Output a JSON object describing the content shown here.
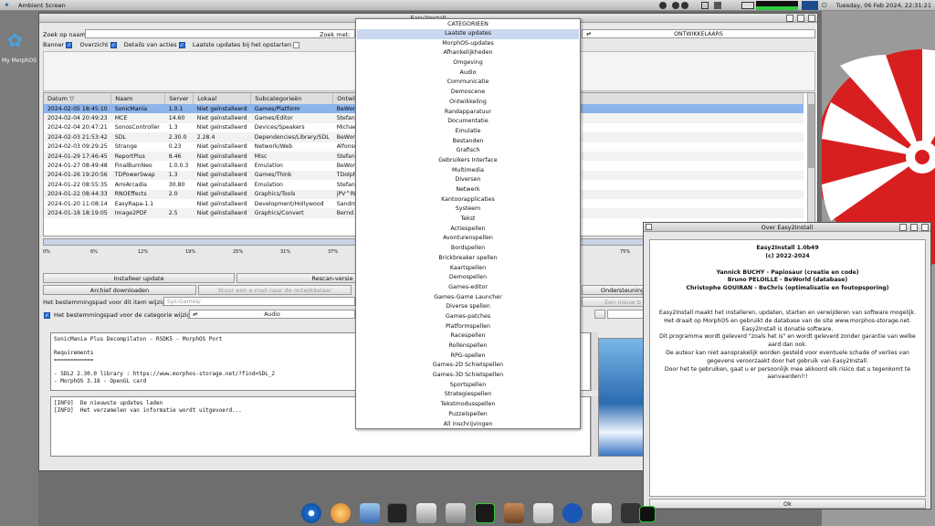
{
  "screenbar": {
    "title": "Ambient Screen",
    "clock": "Tuesday, 06 Feb 2024, 22:31:21"
  },
  "desktop": {
    "icon_label": "My MorphOS"
  },
  "main": {
    "title": "Easy2Install",
    "search_name_label": "Zoek op naam:",
    "search_with_label": "Zoek met:",
    "category_value": "ONTWIKKELAARS",
    "options": [
      {
        "label": "Banner",
        "checked": true
      },
      {
        "label": "Overzicht",
        "checked": true
      },
      {
        "label": "Details van acties",
        "checked": true
      },
      {
        "label": "Laatste updates bij het opstarten",
        "checked": false
      }
    ],
    "columns": [
      "Datum",
      "Naam",
      "Server",
      "Lokaal",
      "Subcategorieën",
      "Ontwikkelaar"
    ],
    "rows": [
      [
        "2024-02-05 18:45:10",
        "SonicMania",
        "1.0.1",
        "Niet geïnstalleerd",
        "Games/Platform",
        "BeWorld"
      ],
      [
        "2024-02-04 20:49:23",
        "MCE",
        "14.60",
        "Niet geïnstalleerd",
        "Games/Editor",
        "Stefan Hau"
      ],
      [
        "2024-02-04 20:47:21",
        "SonosController",
        "1.3",
        "Niet geïnstalleerd",
        "Devices/Speakers",
        "Michael Ru"
      ],
      [
        "2024-02-03 21:53:42",
        "SDL",
        "2.30.0",
        "2.28.4",
        "Dependencies/Library/SDL",
        "BeWorld"
      ],
      [
        "2024-02-03 09:29:25",
        "Strange",
        "0.23",
        "Niet geïnstalleerd",
        "Network/Web",
        "Alfonso Ra"
      ],
      [
        "2024-01-29 17:46:45",
        "ReportPlus",
        "8.46",
        "Niet geïnstalleerd",
        "Misc",
        "Stefan Hau"
      ],
      [
        "2024-01-27 08:49:48",
        "FinalBurnNeo",
        "1.0.0.3",
        "Niet geïnstalleerd",
        "Emulation",
        "BeWorld"
      ],
      [
        "2024-01-26 19:20:56",
        "TDPowerSwap",
        "1.3",
        "Niet geïnstalleerd",
        "Games/Think",
        "TDolphin"
      ],
      [
        "2024-01-22 08:55:35",
        "AmiArcadia",
        "30.80",
        "Niet geïnstalleerd",
        "Emulation",
        "Stefan Hau"
      ],
      [
        "2024-01-22 08:44:33",
        "RNOEffects",
        "2.0",
        "Niet geïnstalleerd",
        "Graphics/Tools",
        "jPV^RNO"
      ],
      [
        "2024-01-20 11:08:14",
        "EasyRapa-1.1",
        "",
        "Niet geïnstalleerd",
        "Development/Hollywood",
        "Sandro Ba"
      ],
      [
        "2024-01-18 18:19:05",
        "Image2PDF",
        "2.5",
        "Niet geïnstalleerd",
        "Graphics/Convert",
        "Bernd Ass"
      ]
    ],
    "progress_ticks": [
      "0%",
      "6%",
      "12%",
      "19%",
      "25%",
      "31%",
      "37%",
      "75%"
    ],
    "btn_install": "Installeer update",
    "btn_rescan": "Rescan-versie",
    "btn_archive": "Archief downloaden",
    "btn_email": "Stuur een e-mail naar de ontwikkelaar",
    "btn_support": "Ondersteuning",
    "btn_new": "Een nieuw b",
    "path_item_label": "Het bestemmingspad voor dit item wijzigen:",
    "path_item_value": "Sys:Games/",
    "path_cat_label": "Het bestemmingspad voor de categorie wijzigen:",
    "path_cat_value": "Audio",
    "readme": "SonicMania Plus Decompilaton - RSDK5 - MorphOS Port\n\nRequirements\n============\n\n- SDL2 2.30.0 library : https://www.morphos-storage.net/?find=SDL_2\n- MorphOS 3.18 - OpenGL card",
    "log": "[INFO]  De nieuwste updates laden\n[INFO]  Het verzamelen van informatie wordt uitgevoerd..."
  },
  "category_menu": {
    "header": "CATEGORIEEN",
    "selected_index": 0,
    "items": [
      "Laatste updates",
      "MorphOS-updates",
      "Afhankelijkheden",
      "Omgeving",
      "Audio",
      "Communicatie",
      "Demoscene",
      "Ontwikkeling",
      "Randapparatuur",
      "Documentatie",
      "Emulatie",
      "Bestanden",
      "Grafisch",
      "Gebruikers Interface",
      "Multimedia",
      "Diversen",
      "Netwerk",
      "Kantoorapplicaties",
      "Systeem",
      "Tekst",
      "Actiespellen",
      "Avonturenspellen",
      "Bordspellen",
      "Brickbreaker spellen",
      "Kaartspellen",
      "Demospellen",
      "Games-editor",
      "Games-Game Launcher",
      "Diverse spellen",
      "Games-patches",
      "Platformspellen",
      "Racespellen",
      "Rollenspellen",
      "RPG-spellen",
      "Games-2D Schietspellen",
      "Games-3D Schietspellen",
      "Sportspellen",
      "Strategiespellen",
      "Tekstmodusspellen",
      "Puzzelspellen",
      "All inschrijvingen"
    ]
  },
  "about": {
    "title": "Over Easy2Install",
    "version": "Easy2Install 1.0b49",
    "copyright": "(c) 2022-2024",
    "credits": [
      "Yannick BUCHY - Papiosaur (creatie en code)",
      "Bruno PELOILLE - BeWorld (database)",
      "Christophe GOUIRAN - BeChris (optimalisatie en foutopsporing)"
    ],
    "lines": [
      "Easy2Install maakt het installeren, updaten, starten en verwijderen van software mogelijk.",
      "Het draait op MorphOS en gebruikt de database van de site www.morphos-storage.net.",
      "Easy2Install is donatie software.",
      "Dit programma wordt geleverd \"zoals het is\" en wordt geleverd zonder garantie van welke",
      "aard dan ook.",
      "De auteur kan niet aansprakelijk worden gesteld voor eventuele schade of verlies van",
      "gegevens veroorzaakt door het gebruik van Easy2Install.",
      "Door het te gebruiken, gaat u er persoonlijk mee akkoord elk risico dat u tegenkomt te",
      "aanvaarden!!!"
    ],
    "ok": "Ok"
  },
  "colors": {
    "selection": "#8db4ea",
    "menu_highlight": "#c9d7ef",
    "checkbox": "#2f6fd6"
  }
}
